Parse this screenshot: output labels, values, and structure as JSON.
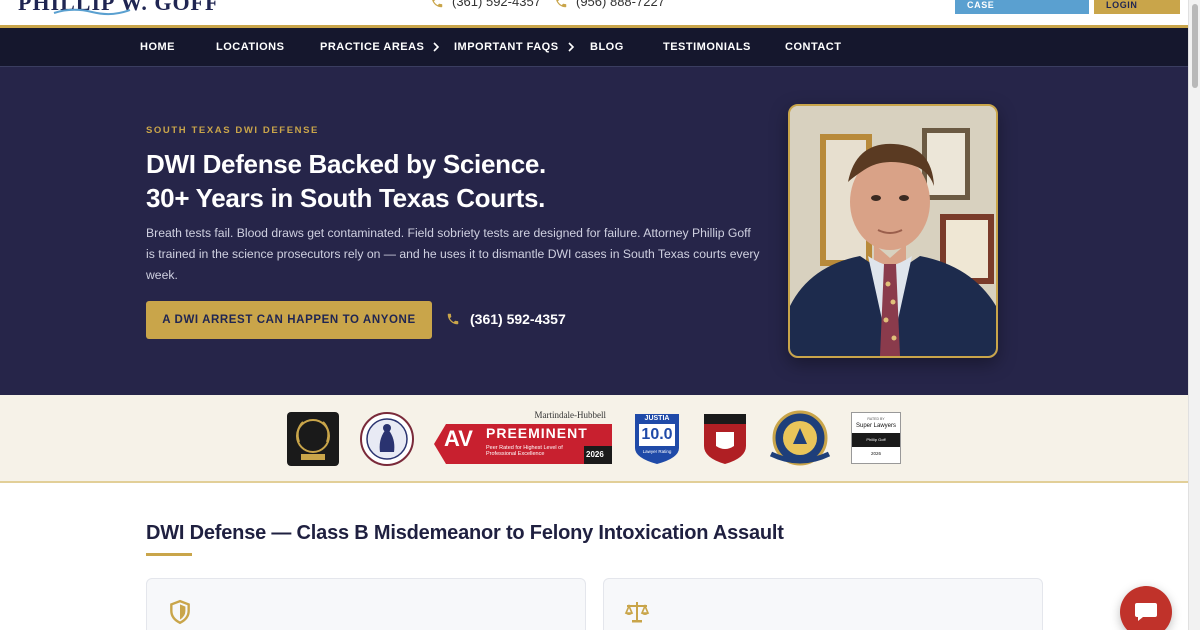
{
  "header": {
    "logo_text": "PHILLIP W. GOFF",
    "phone_primary": "(361) 592-4357",
    "phone_secondary": "(956) 888-7227",
    "talk_button": "TALK ABOUT YOUR CASE",
    "client_login": "CLIENT LOGIN",
    "icons": [
      "phone-icon",
      "phone-icon"
    ]
  },
  "nav": {
    "items": [
      {
        "label": "HOME",
        "has_submenu": false
      },
      {
        "label": "LOCATIONS",
        "has_submenu": false
      },
      {
        "label": "PRACTICE AREAS",
        "has_submenu": true
      },
      {
        "label": "IMPORTANT FAQS",
        "has_submenu": true
      },
      {
        "label": "BLOG",
        "has_submenu": false
      },
      {
        "label": "TESTIMONIALS",
        "has_submenu": false
      },
      {
        "label": "CONTACT",
        "has_submenu": false
      }
    ]
  },
  "hero": {
    "eyebrow": "SOUTH TEXAS DWI DEFENSE",
    "headline_line1": "DWI Defense Backed by Science.",
    "headline_line2": "30+ Years in South Texas Courts.",
    "body": "Breath tests fail. Blood draws get contaminated. Field sobriety tests are designed for failure. Attorney Phillip Goff is trained in the science prosecutors rely on — and he uses it to dismantle DWI cases in South Texas courts every week.",
    "cta_label": "A DWI ARREST CAN HAPPEN TO ANYONE",
    "phone": "(361) 592-4357"
  },
  "badges": {
    "martindale_top": "Martindale-Hubbell",
    "av_letters": "AV",
    "preeminent": "PREEMINENT",
    "av_subtext": "Peer Rated for Highest Level of Professional Excellence",
    "av_year": "2026",
    "justia_label": "JUSTIA",
    "justia_score": "10.0",
    "justia_sub": "Lawyer Rating",
    "sl_top": "RATED BY",
    "sl_name": "Super Lawyers",
    "sl_person": "Phillip Goff",
    "sl_year": "2026"
  },
  "section": {
    "title": "DWI Defense — Class B Misdemeanor to Felony Intoxication Assault"
  },
  "colors": {
    "navy": "#262549",
    "nav_bg": "#15172d",
    "gold": "#c9a54a",
    "chat_red": "#c0322a",
    "sky_button": "#5aa0d0"
  }
}
